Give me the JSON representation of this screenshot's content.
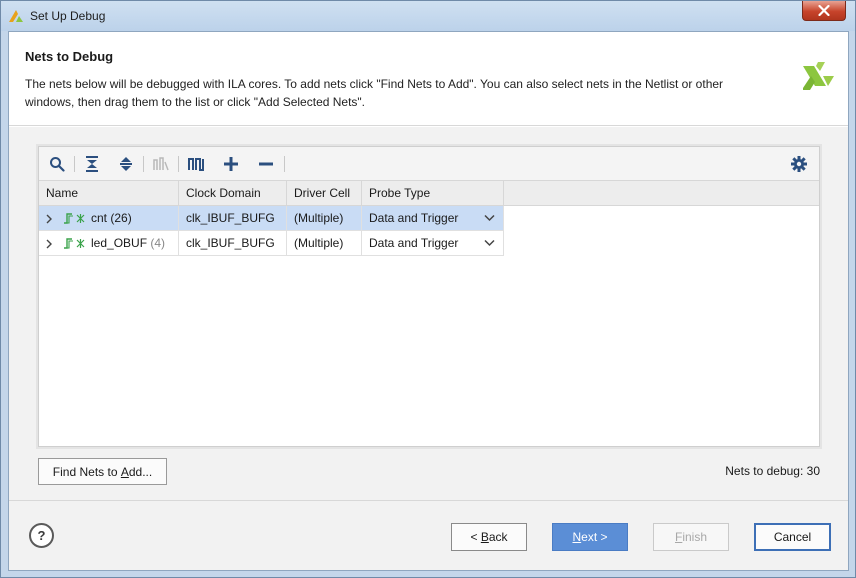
{
  "window": {
    "title": "Set Up Debug"
  },
  "header": {
    "title": "Nets to Debug",
    "description_line1": "The nets below will be debugged with ILA cores. To add nets click \"Find Nets to Add\". You can also select nets in the Netlist or other",
    "description_line2": "windows, then drag them to the list or click \"Add Selected Nets\"."
  },
  "toolbar": {
    "buttons": [
      "search-icon",
      "collapse-all-icon",
      "expand-all-icon",
      "clock-domain-icon",
      "waveform-icon",
      "add-icon",
      "remove-icon",
      "gear-icon"
    ]
  },
  "table": {
    "columns": [
      "Name",
      "Clock Domain",
      "Driver Cell",
      "Probe Type"
    ],
    "rows": [
      {
        "name": "cnt",
        "count": "(26)",
        "clock_domain": "clk_IBUF_BUFG",
        "driver_cell": "(Multiple)",
        "probe_type": "Data and Trigger",
        "selected": true
      },
      {
        "name": "led_OBUF",
        "count": "(4)",
        "clock_domain": "clk_IBUF_BUFG",
        "driver_cell": "(Multiple)",
        "probe_type": "Data and Trigger",
        "selected": false
      }
    ]
  },
  "find_nets_button": {
    "label_pre": "Find Nets to ",
    "label_mn": "A",
    "label_post": "dd..."
  },
  "nets_to_debug": "Nets to debug: 30",
  "footer": {
    "help": "?",
    "back_pre": "< ",
    "back_mn": "B",
    "back_post": "ack",
    "next_mn": "N",
    "next_post": "ext >",
    "finish_mn": "F",
    "finish_post": "inish",
    "cancel": "Cancel"
  },
  "colors": {
    "accent": "#5b8ed6",
    "selected_row": "#c9dcf5",
    "logo_green": "#8cc63f"
  }
}
